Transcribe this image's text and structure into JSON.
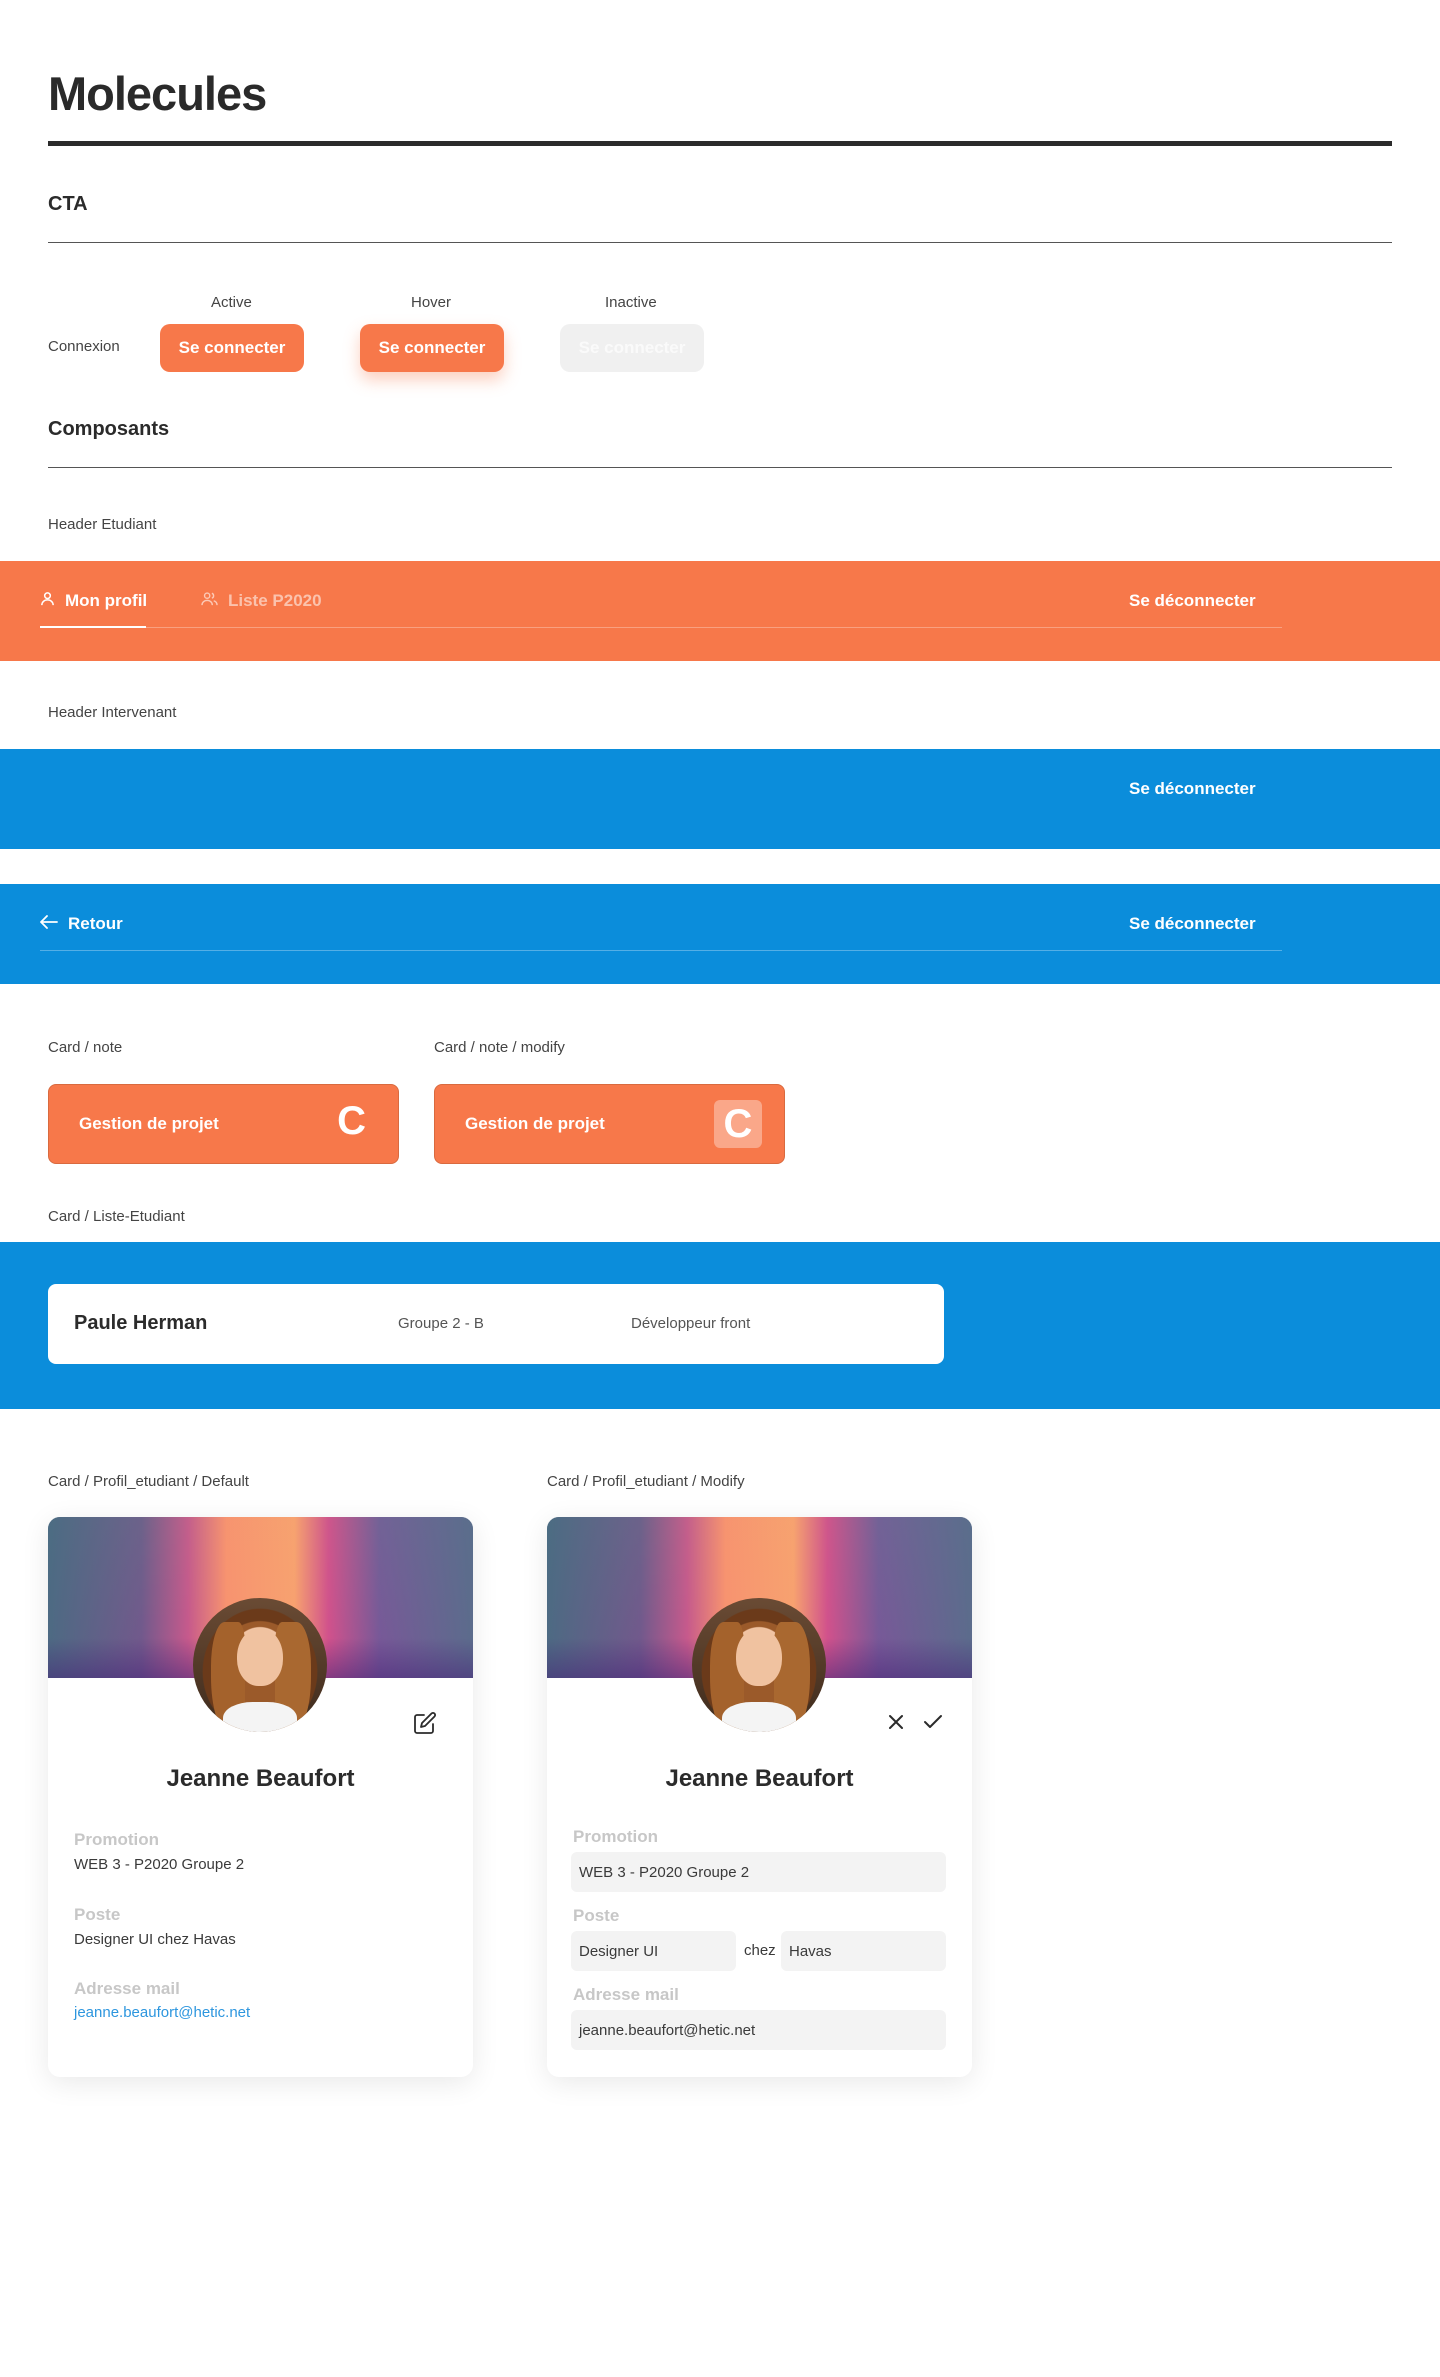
{
  "page": {
    "title": "Molecules"
  },
  "cta": {
    "section_title": "CTA",
    "row_label": "Connexion",
    "states": [
      "Active",
      "Hover",
      "Inactive"
    ],
    "button_label": "Se connecter"
  },
  "components": {
    "section_title": "Composants",
    "header_etudiant": {
      "label": "Header Etudiant",
      "nav": [
        {
          "label": "Mon profil",
          "icon": "user-icon",
          "active": true
        },
        {
          "label": "Liste P2020",
          "icon": "users-icon",
          "active": false
        }
      ],
      "logout": "Se déconnecter"
    },
    "header_intervenant": {
      "label": "Header Intervenant",
      "logout": "Se déconnecter",
      "back_label": "Retour",
      "logout_2": "Se déconnecter"
    },
    "card_note": {
      "label": "Card / note",
      "subject": "Gestion de projet",
      "grade": "C"
    },
    "card_note_modify": {
      "label": "Card / note / modify",
      "subject": "Gestion de projet",
      "grade": "C"
    },
    "card_liste": {
      "label": "Card / Liste-Etudiant",
      "name": "Paule Herman",
      "group": "Groupe 2 - B",
      "role": "Développeur front"
    },
    "profile_default": {
      "label": "Card / Profil_etudiant / Default",
      "name": "Jeanne Beaufort",
      "promotion_label": "Promotion",
      "promotion": "WEB 3 - P2020 Groupe 2",
      "poste_label": "Poste",
      "poste": "Designer UI chez Havas",
      "mail_label": "Adresse mail",
      "mail": "jeanne.beaufort@hetic.net"
    },
    "profile_modify": {
      "label": "Card / Profil_etudiant / Modify",
      "name": "Jeanne Beaufort",
      "promotion_label": "Promotion",
      "promotion": "WEB 3 - P2020 Groupe 2",
      "poste_label": "Poste",
      "poste_role": "Designer UI",
      "poste_sep": "chez",
      "poste_company": "Havas",
      "mail_label": "Adresse mail",
      "mail": "jeanne.beaufort@hetic.net"
    }
  },
  "colors": {
    "primary_orange": "#f7784a",
    "primary_blue": "#0b8ddb",
    "link_blue": "#2d96de",
    "text_dark": "#2b2b2b",
    "muted_label": "#c7c7c7"
  }
}
